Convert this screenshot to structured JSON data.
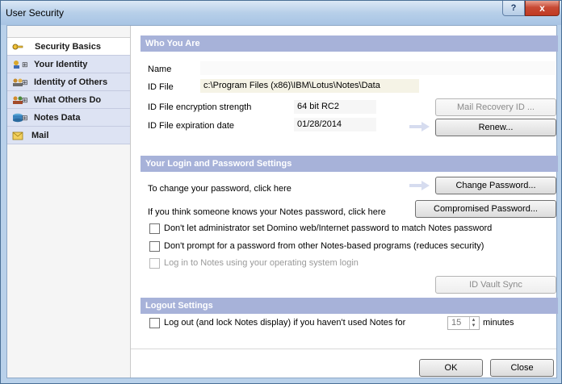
{
  "window": {
    "title": "User Security",
    "help": "?",
    "close": "x"
  },
  "sidebar": {
    "items": [
      {
        "label": "Security Basics",
        "expander": "",
        "icon": "key-icon"
      },
      {
        "label": "Your Identity",
        "expander": "⊞",
        "icon": "identity-icon"
      },
      {
        "label": "Identity of Others",
        "expander": "⊞",
        "icon": "people-icon"
      },
      {
        "label": "What Others Do",
        "expander": "⊞",
        "icon": "shield-people-icon"
      },
      {
        "label": "Notes Data",
        "expander": "⊞",
        "icon": "data-icon"
      },
      {
        "label": "Mail",
        "expander": "",
        "icon": "mail-icon"
      }
    ]
  },
  "who_you_are": {
    "header": "Who You Are",
    "name_label": "Name",
    "name_value": "",
    "id_file_label": "ID File",
    "id_file_value": "c:\\Program Files (x86)\\IBM\\Lotus\\Notes\\Data",
    "encryption_label": "ID File encryption strength",
    "encryption_value": "64 bit RC2",
    "expiration_label": "ID File expiration date",
    "expiration_value": "01/28/2014",
    "mail_recovery_button": "Mail Recovery ID ...",
    "renew_button": "Renew..."
  },
  "login": {
    "header": "Your Login and Password Settings",
    "change_text": "To change your password, click here",
    "change_button": "Change Password...",
    "compromised_text": "If you think someone knows your Notes password, click here",
    "compromised_button": "Compromised Password...",
    "opt1": "Don't let administrator set Domino web/Internet password to match Notes password",
    "opt2": "Don't prompt for a password from other Notes-based programs (reduces security)",
    "opt3": "Log in to Notes using your operating system login",
    "vault_button": "ID Vault Sync"
  },
  "logout": {
    "header": "Logout Settings",
    "text": "Log out (and lock Notes display) if you haven't used Notes for",
    "minutes_value": "15",
    "minutes_label": "minutes"
  },
  "footer": {
    "ok": "OK",
    "close": "Close"
  }
}
